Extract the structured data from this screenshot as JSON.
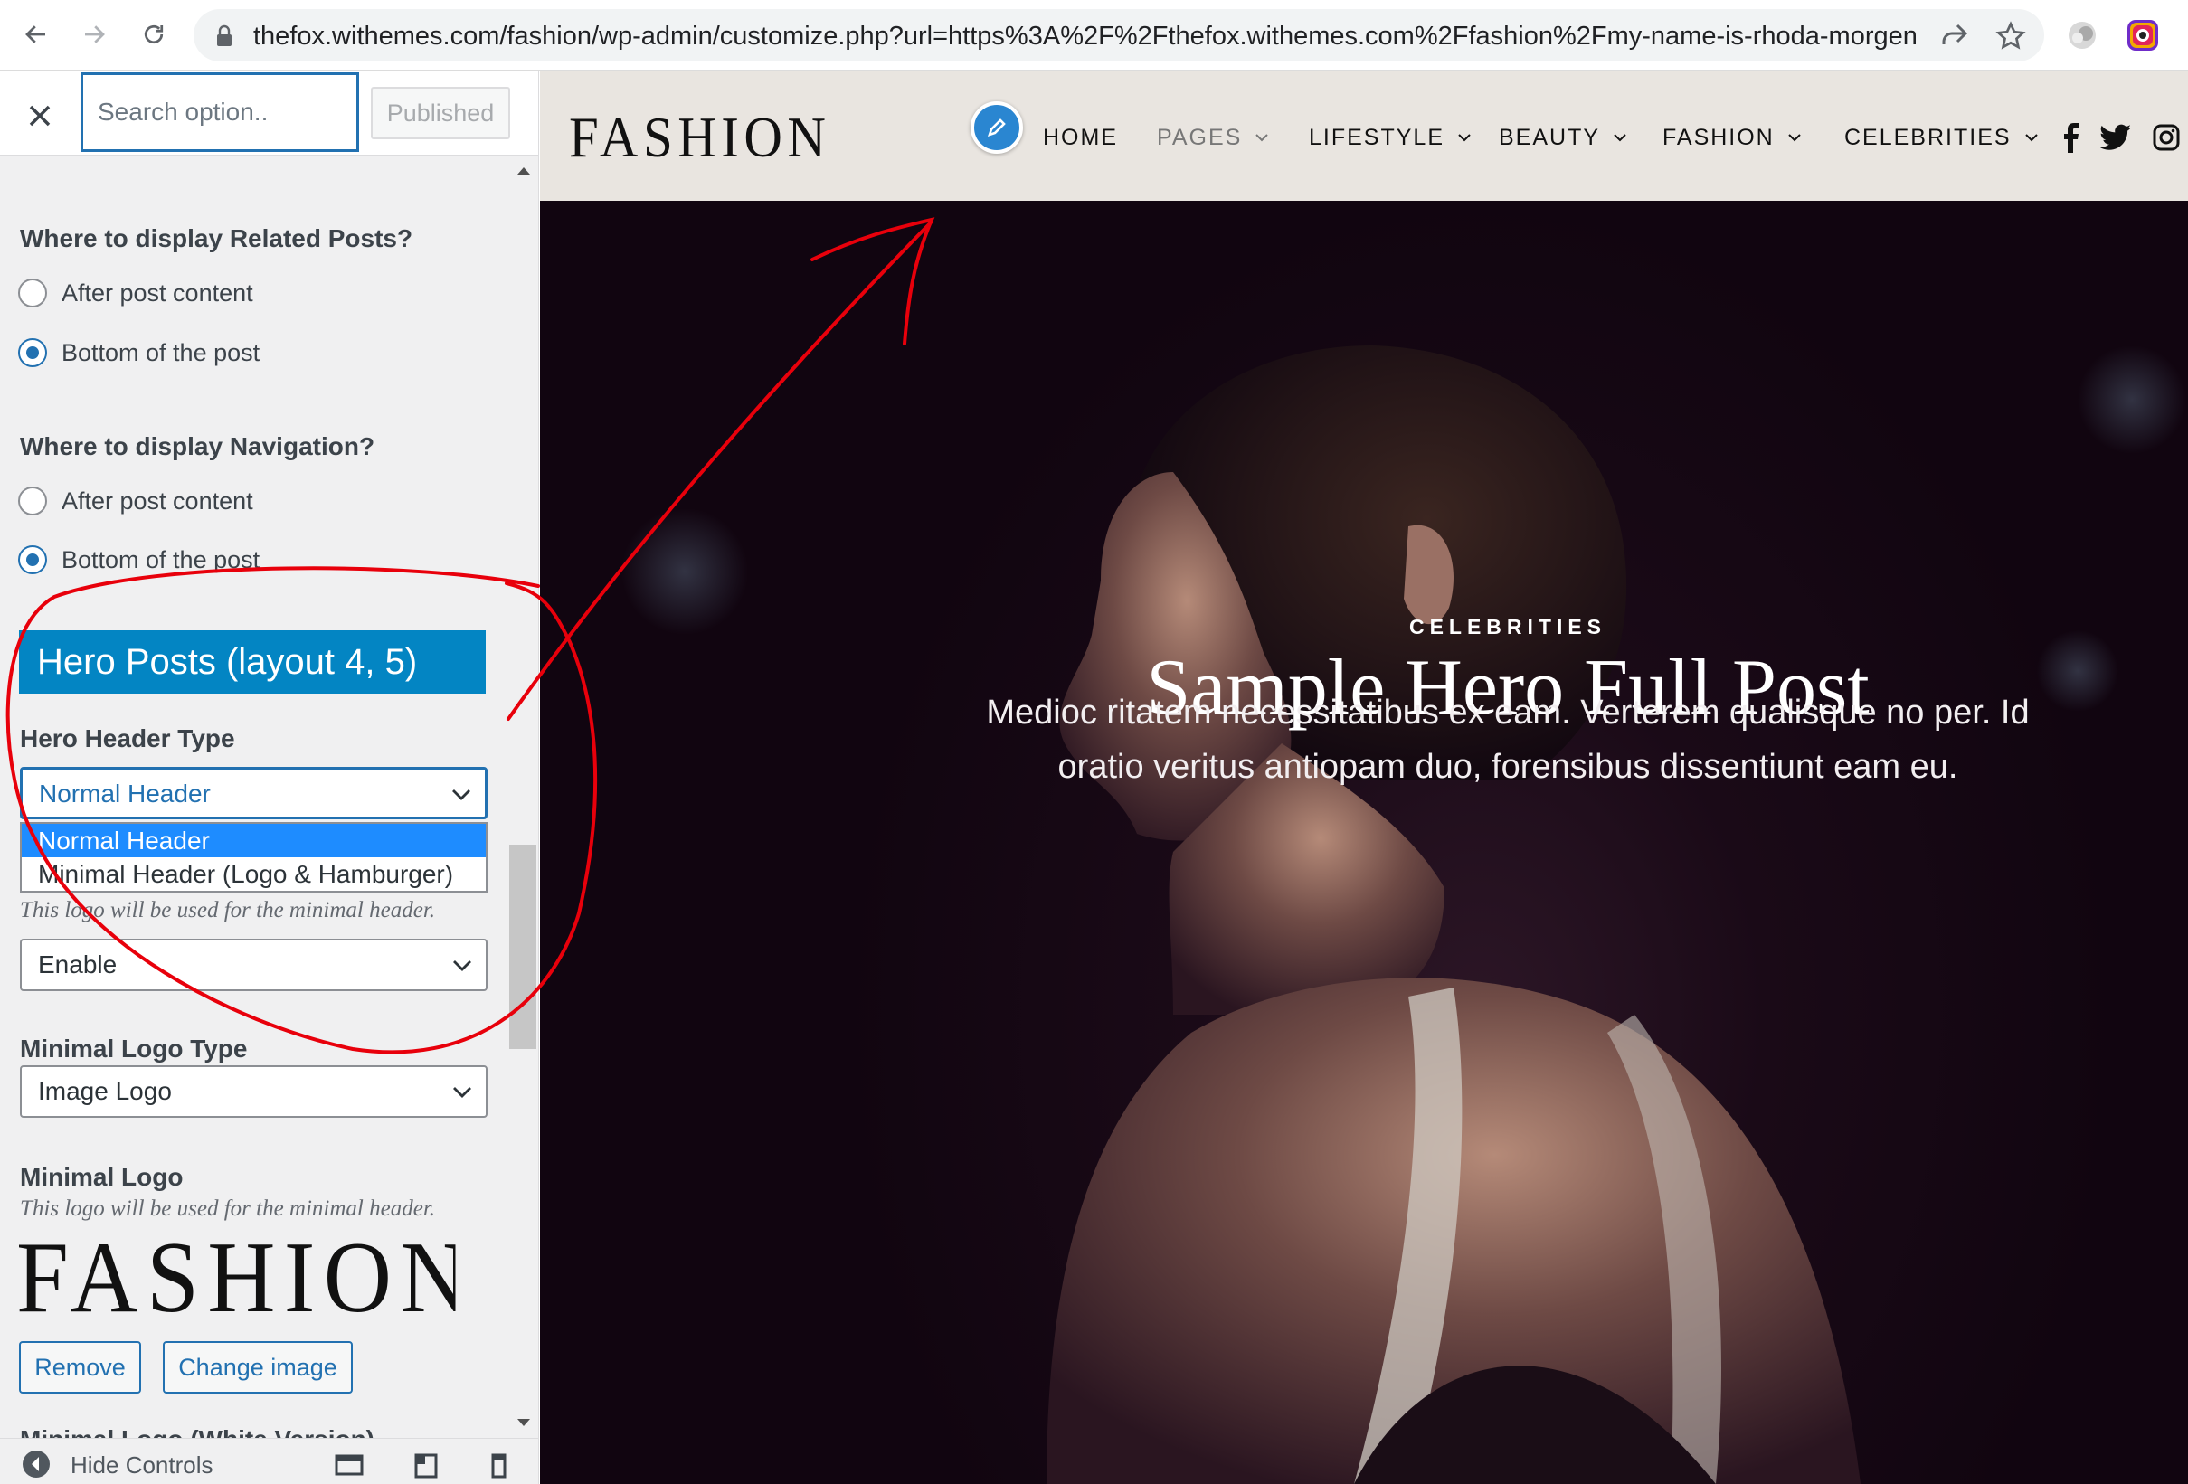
{
  "browser": {
    "url": "thefox.withemes.com/fashion/wp-admin/customize.php?url=https%3A%2F%2Fthefox.withemes.com%2Ffashion%2Fmy-name-is-rhoda-morgenster..."
  },
  "sidebar": {
    "search_placeholder": "Search option..",
    "published_label": "Published",
    "related_posts": {
      "label": "Where to display Related Posts?",
      "options": [
        "After post content",
        "Bottom of the post"
      ],
      "selected": "Bottom of the post"
    },
    "navigation": {
      "label": "Where to display Navigation?",
      "options": [
        "After post content",
        "Bottom of the post"
      ],
      "selected": "Bottom of the post"
    },
    "hero_section_title": "Hero Posts (layout 4, 5)",
    "hero_header_type": {
      "label": "Hero Header Type",
      "value": "Normal Header",
      "options": [
        "Normal Header",
        "Minimal Header (Logo & Hamburger)"
      ]
    },
    "minimal_logo_desc": "This logo will be used for the minimal header.",
    "enable_select_value": "Enable",
    "minimal_logo_type": {
      "label": "Minimal Logo Type",
      "value": "Image Logo"
    },
    "minimal_logo": {
      "label": "Minimal Logo",
      "desc": "This logo will be used for the minimal header.",
      "logo_text": "FASHION",
      "remove_label": "Remove",
      "change_label": "Change image"
    },
    "next_label_cut": "Minimal Logo (White Version)",
    "footer": {
      "hide_controls": "Hide Controls"
    }
  },
  "preview": {
    "logo": "FASHION",
    "menu": [
      {
        "label": "HOME",
        "has_dropdown": false,
        "muted": false
      },
      {
        "label": "PAGES",
        "has_dropdown": true,
        "muted": true
      },
      {
        "label": "LIFESTYLE",
        "has_dropdown": true,
        "muted": false
      },
      {
        "label": "BEAUTY",
        "has_dropdown": true,
        "muted": false
      },
      {
        "label": "FASHION",
        "has_dropdown": true,
        "muted": false
      },
      {
        "label": "CELEBRITIES",
        "has_dropdown": true,
        "muted": false
      }
    ],
    "hero": {
      "category": "CELEBRITIES",
      "title": "Sample Hero Full Post",
      "excerpt": "Medioc ritatem necessitatibus ex eam. Verterem qualisque no per. Id oratio veritus antiopam duo, forensibus dissentiunt eam eu."
    }
  },
  "colors": {
    "wp_blue": "#2271b1",
    "section_blue": "#0385c3",
    "dropdown_highlight": "#1e8cff",
    "annotation_red": "#e8000b",
    "header_bg": "#e9e5e0",
    "hero_bg": "#140713"
  }
}
